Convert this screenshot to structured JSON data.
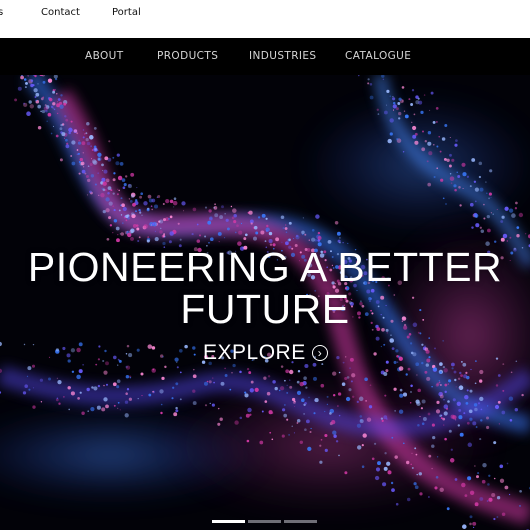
{
  "utility_nav": {
    "items": [
      {
        "label": "s"
      },
      {
        "label": "Contact"
      },
      {
        "label": "Portal"
      }
    ]
  },
  "main_nav": {
    "items": [
      {
        "label": "ABOUT"
      },
      {
        "label": "PRODUCTS"
      },
      {
        "label": "INDUSTRIES"
      },
      {
        "label": "CATALOGUE"
      }
    ]
  },
  "hero": {
    "headline_line1": "PIONEERING A BETTER",
    "headline_line2": "FUTURE",
    "cta_label": "EXPLORE",
    "cta_icon": "chevron-right-circle-icon",
    "slides": {
      "count": 3,
      "active": 1
    },
    "colors": {
      "blue": "#3a7bff",
      "magenta": "#d63aa8",
      "background": "#020208"
    }
  }
}
